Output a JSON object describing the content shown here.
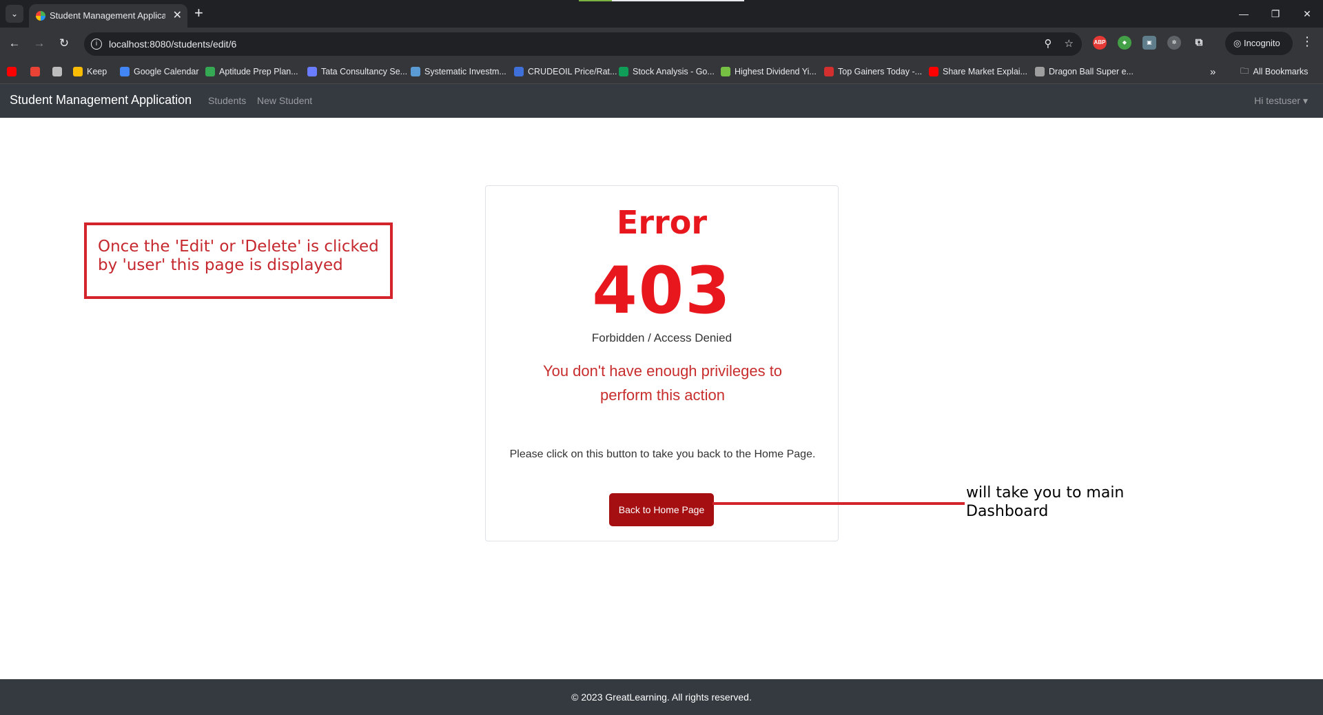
{
  "browser": {
    "tab_title": "Student Management Applicati",
    "tab_close": "✕",
    "new_tab": "+",
    "url": "localhost:8080/students/edit/6",
    "incognito_label": "Incognito",
    "window_controls": [
      "—",
      "❐",
      "✕"
    ],
    "bookmarks": [
      {
        "label": "",
        "icon": "youtube-icon",
        "color": "#ff0000"
      },
      {
        "label": "",
        "icon": "gmail-icon",
        "color": "#ea4335"
      },
      {
        "label": "",
        "icon": "folder-icon",
        "color": "#bdbdbd"
      },
      {
        "label": "Keep",
        "icon": "keep-icon",
        "color": "#fbbc04"
      },
      {
        "label": "Google Calendar",
        "icon": "calendar-icon",
        "color": "#4285f4"
      },
      {
        "label": "Aptitude Prep Plan...",
        "icon": "prep-icon",
        "color": "#34a853"
      },
      {
        "label": "Tata Consultancy Se...",
        "icon": "tcs-icon",
        "color": "#6a7cff"
      },
      {
        "label": "Systematic Investm...",
        "icon": "sip-icon",
        "color": "#5b9bd5"
      },
      {
        "label": "CRUDEOIL Price/Rat...",
        "icon": "crude-icon",
        "color": "#3f6fd8"
      },
      {
        "label": "Stock Analysis - Go...",
        "icon": "sheets-icon",
        "color": "#0f9d58"
      },
      {
        "label": "Highest Dividend Yi...",
        "icon": "chart-icon",
        "color": "#76c043"
      },
      {
        "label": "Top Gainers Today -...",
        "icon": "et-icon",
        "color": "#d32f2f"
      },
      {
        "label": "Share Market Explai...",
        "icon": "youtube-icon",
        "color": "#ff0000"
      },
      {
        "label": "Dragon Ball Super e...",
        "icon": "globe-icon",
        "color": "#9e9e9e"
      }
    ],
    "all_bookmarks": "All Bookmarks",
    "overflow": "»"
  },
  "app": {
    "brand": "Student Management Application",
    "nav_students": "Students",
    "nav_new_student": "New Student",
    "user_menu": "Hi testuser ▾"
  },
  "error_card": {
    "title": "Error",
    "code": "403",
    "subtitle": "Forbidden / Access Denied",
    "message": "You don't have enough privileges to perform this action",
    "help": "Please click on this button to take you back to the Home Page.",
    "button": "Back to Home Page"
  },
  "annotations": {
    "box_text": "Once the 'Edit' or 'Delete' is clicked by 'user' this page is displayed",
    "side_text": "will take you to main Dashboard"
  },
  "footer": {
    "text": "© 2023 GreatLearning. All rights reserved."
  },
  "colors": {
    "error_red": "#e8171e",
    "button_red": "#a50f12",
    "navbar": "#343a40",
    "annotation_red": "#d3232b"
  }
}
